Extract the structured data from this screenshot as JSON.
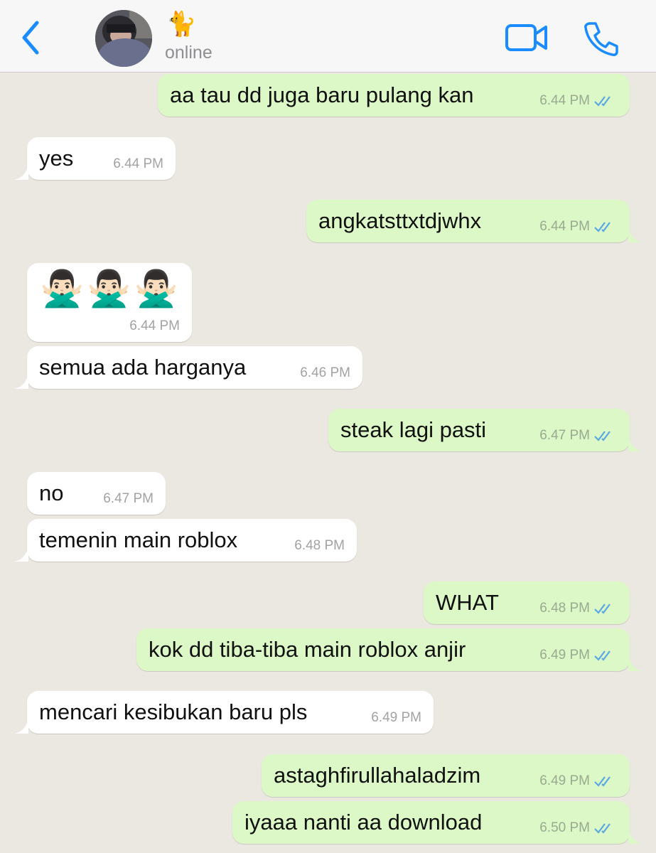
{
  "header": {
    "back_label": "back",
    "contact_name": "🐈",
    "status": "online"
  },
  "colors": {
    "accent": "#1a8cff",
    "outgoing_bubble": "#dcf8c6",
    "incoming_bubble": "#ffffff",
    "chat_background": "#ebe8e1",
    "read_ticks": "#5aa7e6"
  },
  "icons": {
    "back": "chevron-left-icon",
    "video": "video-camera-icon",
    "call": "phone-icon",
    "read_receipt": "double-check-icon"
  },
  "messages": [
    {
      "direction": "out",
      "text": "aa tau dd juga baru pulang kan",
      "time": "6.44 PM",
      "read": true
    },
    {
      "direction": "in",
      "text": "yes",
      "time": "6.44 PM"
    },
    {
      "direction": "out",
      "text": "angkatsttxtdjwhx",
      "time": "6.44 PM",
      "read": true
    },
    {
      "direction": "in",
      "text": "🙅🏻‍♂️🙅🏻‍♂️🙅🏻‍♂️",
      "time": "6.44 PM",
      "emoji_only": true
    },
    {
      "direction": "in",
      "text": "semua ada harganya",
      "time": "6.46 PM"
    },
    {
      "direction": "out",
      "text": "steak lagi pasti",
      "time": "6.47 PM",
      "read": true
    },
    {
      "direction": "in",
      "text": "no",
      "time": "6.47 PM"
    },
    {
      "direction": "in",
      "text": "temenin main roblox",
      "time": "6.48 PM"
    },
    {
      "direction": "out",
      "text": "WHAT",
      "time": "6.48 PM",
      "read": true
    },
    {
      "direction": "out",
      "text": "kok dd tiba-tiba main roblox anjir",
      "time": "6.49 PM",
      "read": true
    },
    {
      "direction": "in",
      "text": "mencari kesibukan baru pls",
      "time": "6.49 PM"
    },
    {
      "direction": "out",
      "text": "astaghfirullahaladzim",
      "time": "6.49 PM",
      "read": true
    },
    {
      "direction": "out",
      "text": "iyaaa nanti aa download",
      "time": "6.50 PM",
      "read": true
    }
  ]
}
